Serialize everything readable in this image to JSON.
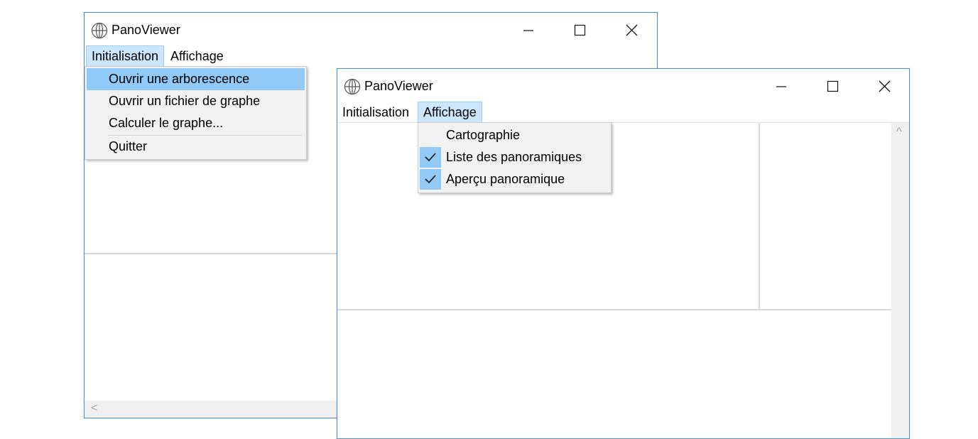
{
  "window_back": {
    "title": "PanoViewer",
    "menu": [
      "Initialisation",
      "Affichage"
    ],
    "active_menu": "Initialisation",
    "dropdown": [
      {
        "label": "Ouvrir une arborescence",
        "highlighted": true
      },
      {
        "label": "Ouvrir un fichier de graphe",
        "highlighted": false
      },
      {
        "label": "Calculer le graphe...",
        "highlighted": false
      },
      {
        "label": "Quitter",
        "highlighted": false,
        "separator_before": true
      }
    ],
    "scroll_left_glyph": "<"
  },
  "window_front": {
    "title": "PanoViewer",
    "menu": [
      "Initialisation",
      "Affichage"
    ],
    "active_menu": "Affichage",
    "dropdown": [
      {
        "label": "Cartographie",
        "checked": false
      },
      {
        "label": "Liste des panoramiques",
        "checked": true
      },
      {
        "label": "Aperçu panoramique",
        "checked": true
      }
    ],
    "scroll_up_glyph": "^"
  },
  "colors": {
    "window_border": "#4a8fc7",
    "menu_highlight": "#91c9f7",
    "active_menu_bg": "#cce6fb",
    "dropdown_bg": "#f2f2f2"
  },
  "icons": {
    "app": "globe-icon",
    "minimize": "minimize-icon",
    "maximize": "maximize-icon",
    "close": "close-icon",
    "check": "check-icon"
  }
}
